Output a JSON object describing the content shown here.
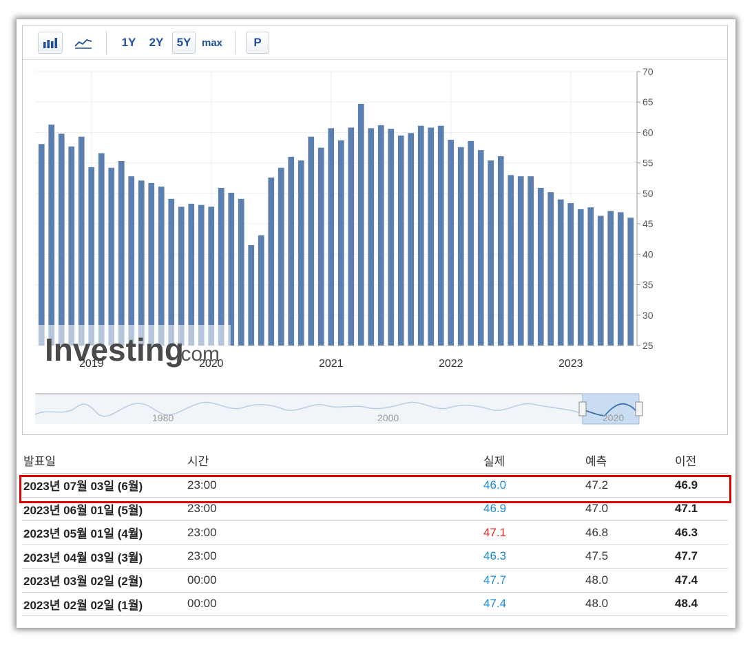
{
  "toolbar": {
    "bar_chart_icon": "bar-chart-icon",
    "line_chart_icon": "line-chart-icon",
    "range_1y": "1Y",
    "range_2y": "2Y",
    "range_5y": "5Y",
    "range_max": "max",
    "p_button": "P"
  },
  "watermark": {
    "brand": "Investing",
    "suffix": ".com"
  },
  "navigator": {
    "labels": [
      "1980",
      "2000",
      "2020"
    ]
  },
  "chart_data": {
    "type": "bar",
    "x": [
      "2018-08",
      "2018-09",
      "2018-10",
      "2018-11",
      "2018-12",
      "2019-01",
      "2019-02",
      "2019-03",
      "2019-04",
      "2019-05",
      "2019-06",
      "2019-07",
      "2019-08",
      "2019-09",
      "2019-10",
      "2019-11",
      "2019-12",
      "2020-01",
      "2020-02",
      "2020-03",
      "2020-04",
      "2020-05",
      "2020-06",
      "2020-07",
      "2020-08",
      "2020-09",
      "2020-10",
      "2020-11",
      "2020-12",
      "2021-01",
      "2021-02",
      "2021-03",
      "2021-04",
      "2021-05",
      "2021-06",
      "2021-07",
      "2021-08",
      "2021-09",
      "2021-10",
      "2021-11",
      "2021-12",
      "2022-01",
      "2022-02",
      "2022-03",
      "2022-04",
      "2022-05",
      "2022-06",
      "2022-07",
      "2022-08",
      "2022-09",
      "2022-10",
      "2022-11",
      "2022-12",
      "2023-01",
      "2023-02",
      "2023-03",
      "2023-04",
      "2023-05",
      "2023-06"
    ],
    "values": [
      58.1,
      61.3,
      59.8,
      57.7,
      59.3,
      54.3,
      56.6,
      54.2,
      55.3,
      52.8,
      52.1,
      51.7,
      51.1,
      49.1,
      47.8,
      48.3,
      48.1,
      47.8,
      50.9,
      50.1,
      49.1,
      41.5,
      43.1,
      52.6,
      54.2,
      56.0,
      55.4,
      59.3,
      57.5,
      60.7,
      58.7,
      60.8,
      64.7,
      60.7,
      61.2,
      60.6,
      59.5,
      59.9,
      61.1,
      60.8,
      61.1,
      58.8,
      57.6,
      58.6,
      57.1,
      55.4,
      56.1,
      53.0,
      52.8,
      52.8,
      50.9,
      50.2,
      49.0,
      48.4,
      47.4,
      47.7,
      46.3,
      47.1,
      46.9,
      46.0
    ],
    "year_labels": [
      "2019",
      "2020",
      "2021",
      "2022",
      "2023"
    ],
    "ylim": [
      25,
      70
    ],
    "yticks": [
      25,
      30,
      35,
      40,
      45,
      50,
      55,
      60,
      65,
      70
    ],
    "bar_color": "#5b7fae",
    "grid": true
  },
  "table": {
    "headers": {
      "date": "발표일",
      "time": "시간",
      "actual": "실제",
      "forecast": "예측",
      "previous": "이전"
    },
    "rows": [
      {
        "date": "2023년 07월 03일 (6월)",
        "time": "23:00",
        "actual": "46.0",
        "actual_color": "#1a8ad7",
        "forecast": "47.2",
        "previous": "46.9"
      },
      {
        "date": "2023년 06월 01일 (5월)",
        "time": "23:00",
        "actual": "46.9",
        "actual_color": "#1a8ad7",
        "forecast": "47.0",
        "previous": "47.1"
      },
      {
        "date": "2023년 05월 01일 (4월)",
        "time": "23:00",
        "actual": "47.1",
        "actual_color": "#e8261f",
        "forecast": "46.8",
        "previous": "46.3"
      },
      {
        "date": "2023년 04월 03일 (3월)",
        "time": "23:00",
        "actual": "46.3",
        "actual_color": "#1a8ad7",
        "forecast": "47.5",
        "previous": "47.7"
      },
      {
        "date": "2023년 03월 02일 (2월)",
        "time": "00:00",
        "actual": "47.7",
        "actual_color": "#1a8ad7",
        "forecast": "48.0",
        "previous": "47.4"
      },
      {
        "date": "2023년 02월 02일 (1월)",
        "time": "00:00",
        "actual": "47.4",
        "actual_color": "#1a8ad7",
        "forecast": "48.0",
        "previous": "48.4"
      }
    ]
  }
}
